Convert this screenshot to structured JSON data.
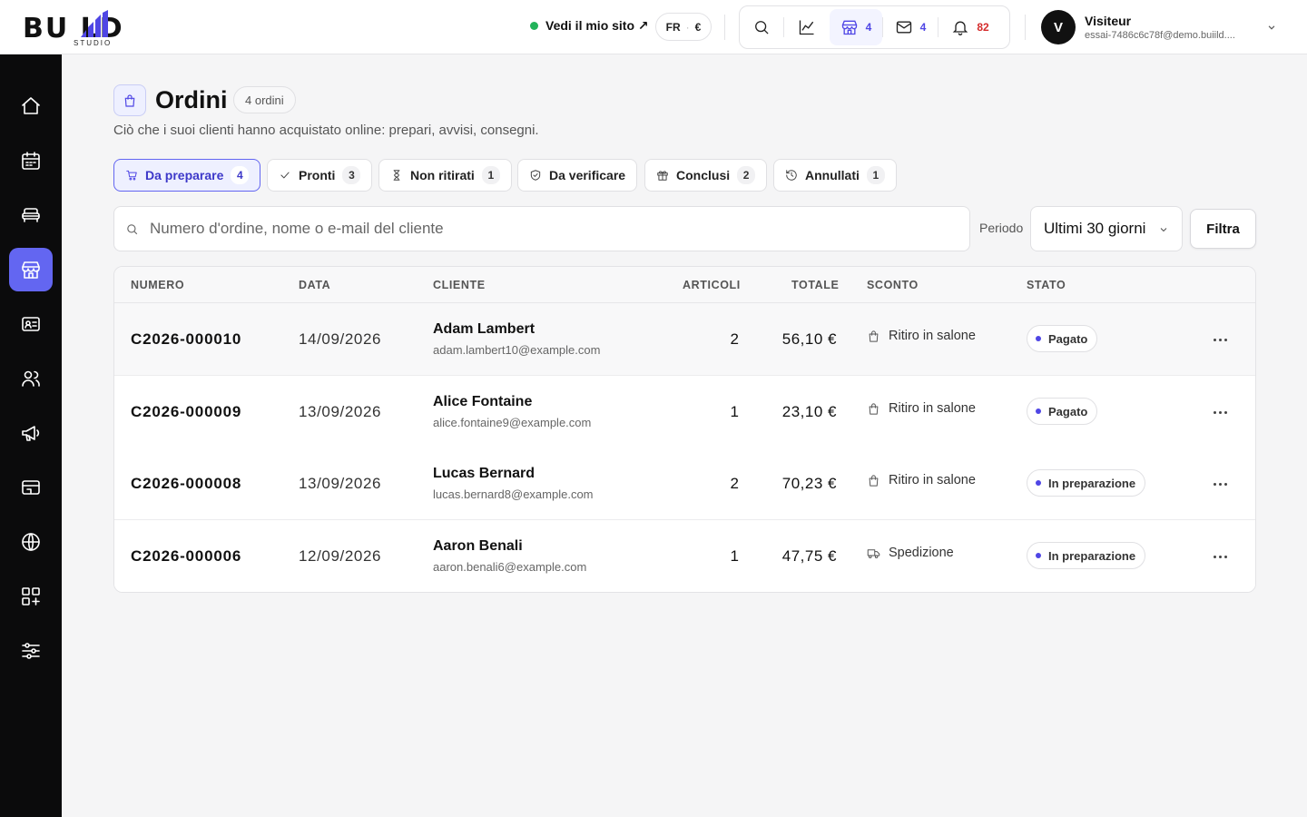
{
  "brand": {
    "logo_main": "BU  LD",
    "logo_sub": "STUDIO"
  },
  "topbar": {
    "site_link": "Vedi il mio sito ↗",
    "locale": "FR",
    "currency": "€",
    "tools": {
      "orders_count": "4",
      "messages_count": "4",
      "notifications_count": "82"
    },
    "user": {
      "initial": "V",
      "name": "Visiteur",
      "email": "essai-7486c6c78f@demo.buiild...."
    }
  },
  "page": {
    "title": "Ordini",
    "count_label": "4 ordini",
    "subtitle": "Ciò che i suoi clienti hanno acquistato online: prepari, avvisi, consegni."
  },
  "tabs": [
    {
      "label": "Da preparare",
      "count": "4"
    },
    {
      "label": "Pronti",
      "count": "3"
    },
    {
      "label": "Non ritirati",
      "count": "1"
    },
    {
      "label": "Da verificare",
      "count": ""
    },
    {
      "label": "Conclusi",
      "count": "2"
    },
    {
      "label": "Annullati",
      "count": "1"
    }
  ],
  "search": {
    "placeholder": "Numero d'ordine, nome o e-mail del cliente",
    "value": ""
  },
  "period": {
    "label": "Periodo",
    "selected": "Ultimi 30 giorni"
  },
  "filter_label": "Filtra",
  "table": {
    "headers": [
      "NUMERO",
      "DATA",
      "CLIENTE",
      "ARTICOLI",
      "TOTALE",
      "SCONTO",
      "STATO"
    ],
    "rows": [
      {
        "number": "C2026-000010",
        "date": "14/09/2026",
        "name": "Adam Lambert",
        "email": "adam.lambert10@example.com",
        "items": "2",
        "total": "56,10 €",
        "delivery": "Ritiro in salone",
        "delivery_icon": "bag-icon",
        "status": "Pagato"
      },
      {
        "number": "C2026-000009",
        "date": "13/09/2026",
        "name": "Alice Fontaine",
        "email": "alice.fontaine9@example.com",
        "items": "1",
        "total": "23,10 €",
        "delivery": "Ritiro in salone",
        "delivery_icon": "bag-icon",
        "status": "Pagato"
      },
      {
        "number": "C2026-000008",
        "date": "13/09/2026",
        "name": "Lucas Bernard",
        "email": "lucas.bernard8@example.com",
        "items": "2",
        "total": "70,23 €",
        "delivery": "Ritiro in salone",
        "delivery_icon": "bag-icon",
        "status": "In preparazione"
      },
      {
        "number": "C2026-000006",
        "date": "12/09/2026",
        "name": "Aaron Benali",
        "email": "aaron.benali6@example.com",
        "items": "1",
        "total": "47,75 €",
        "delivery": "Spedizione",
        "delivery_icon": "truck-icon",
        "status": "In preparazione"
      }
    ]
  },
  "colors": {
    "accent": "#6366f1",
    "accent_dark": "#4f46e5",
    "online_dot": "#22b35a",
    "notification": "#d42b2b",
    "sidebar_bg": "#0b0b0c"
  }
}
